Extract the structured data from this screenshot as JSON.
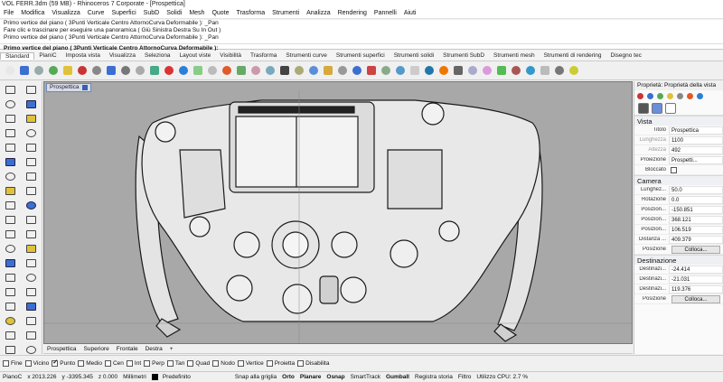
{
  "window": {
    "title": "VOL FERR.3dm (59 MB) - Rhinoceros 7 Corporate - [Prospettica]"
  },
  "menu": [
    "File",
    "Modifica",
    "Visualizza",
    "Curve",
    "Superfici",
    "SubD",
    "Solidi",
    "Mesh",
    "Quote",
    "Trasforma",
    "Strumenti",
    "Analizza",
    "Rendering",
    "Pannelli",
    "Aiuti"
  ],
  "command_history": [
    "Primo vertice del piano ( 3Punti  Verticale  Centro  AttornoCurva  Deformabile ): _Pan",
    "Fare clic e trascinare per eseguire una panoramica ( Giù  Sinistra  Destra  Su  In  Out )",
    "Primo vertice del piano ( 3Punti  Verticale  Centro  AttornoCurva  Deformabile ): _Pan"
  ],
  "command_prompt": "Primo vertice del piano ( 3Punti  Verticale  Centro  AttornoCurva  Deformabile ):",
  "toolbar_tabs": [
    "Standard",
    "PianiC",
    "Imposta vista",
    "Visualizza",
    "Seleziona",
    "Layout viste",
    "Visibilità",
    "Trasforma",
    "Strumenti curve",
    "Strumenti superfici",
    "Strumenti solidi",
    "Strumenti SubD",
    "Strumenti mesh",
    "Strumenti di rendering",
    "Disegno tec"
  ],
  "toolbar_icon_colors": [
    "#e8e8e8",
    "#3b6fd1",
    "#9aa",
    "#5a5",
    "#e0c23a",
    "#c33",
    "#888",
    "#3b6fd1",
    "#777",
    "#aaa",
    "#4a8",
    "#d33",
    "#2b7fd8",
    "#8c8",
    "#bbb",
    "#e05a2a",
    "#6a6",
    "#c9a",
    "#7ab",
    "#444",
    "#aa7",
    "#5a8fd8",
    "#d6a93a",
    "#999",
    "#3b6fd1",
    "#c44",
    "#8a8",
    "#59c",
    "#ccc",
    "#27a",
    "#e70",
    "#666",
    "#aac",
    "#d9d",
    "#5b5",
    "#a55",
    "#39c",
    "#bbb",
    "#777",
    "#cc3"
  ],
  "viewport": {
    "label": "Prospettica",
    "tabs": [
      "Prospettica",
      "Superiore",
      "Frontale",
      "Destra"
    ],
    "add_tab": "+"
  },
  "panel": {
    "title": "Proprietà: Proprietà della vista",
    "vista": {
      "header": "Vista",
      "titolo_label": "Titolo",
      "titolo": "Prospettica",
      "lunghezza_label": "Lunghezza",
      "lunghezza": "1100",
      "altezza_label": "Altezza",
      "altezza": "492",
      "proiezione_label": "Proiezione",
      "proiezione": "Prospetti...",
      "bloccato_label": "Bloccato"
    },
    "camera": {
      "header": "Camera",
      "lunghezza_label": "Lunghez...",
      "lunghezza": "50.0",
      "rotazione_label": "Rotazione",
      "rotazione": "0.0",
      "posx_label": "Posizion...",
      "posx": "-150.851",
      "posy_label": "Posizion...",
      "posy": "368.121",
      "posz_label": "Posizion...",
      "posz": "106.519",
      "distanza_label": "Distanza ...",
      "distanza": "409.379",
      "posizione_label": "Posizione",
      "colloca": "Colloca..."
    },
    "destinazione": {
      "header": "Destinazione",
      "dx_label": "Destinazi...",
      "dx": "-24.414",
      "dy_label": "Destinazi...",
      "dy": "-21.031",
      "dz_label": "Destinazi...",
      "dz": "119.376",
      "posizione_label": "Posizione",
      "colloca": "Colloca..."
    }
  },
  "osnap": [
    {
      "label": "Fine",
      "on": false
    },
    {
      "label": "Vicino",
      "on": false
    },
    {
      "label": "Punto",
      "on": true
    },
    {
      "label": "Medio",
      "on": false
    },
    {
      "label": "Cen",
      "on": false
    },
    {
      "label": "Int",
      "on": false
    },
    {
      "label": "Perp",
      "on": false
    },
    {
      "label": "Tan",
      "on": false
    },
    {
      "label": "Quad",
      "on": false
    },
    {
      "label": "Nodo",
      "on": false
    },
    {
      "label": "Vertice",
      "on": false
    },
    {
      "label": "Proietta",
      "on": false
    },
    {
      "label": "Disabilita",
      "on": false
    }
  ],
  "status": {
    "cplane": "PianoC",
    "x": "x 2013.226",
    "y": "y -3395.345",
    "z": "z 0.000",
    "units": "Millimetri",
    "layer": "Predefinito",
    "snap": "Snap alla griglia",
    "orto": "Orto",
    "planare": "Planare",
    "osnap": "Osnap",
    "smarttrack": "SmartTrack",
    "gumball": "Gumball",
    "registra": "Registra storia",
    "filtro": "Filtro",
    "cpu": "Utilizzo CPU: 2.7 %"
  }
}
